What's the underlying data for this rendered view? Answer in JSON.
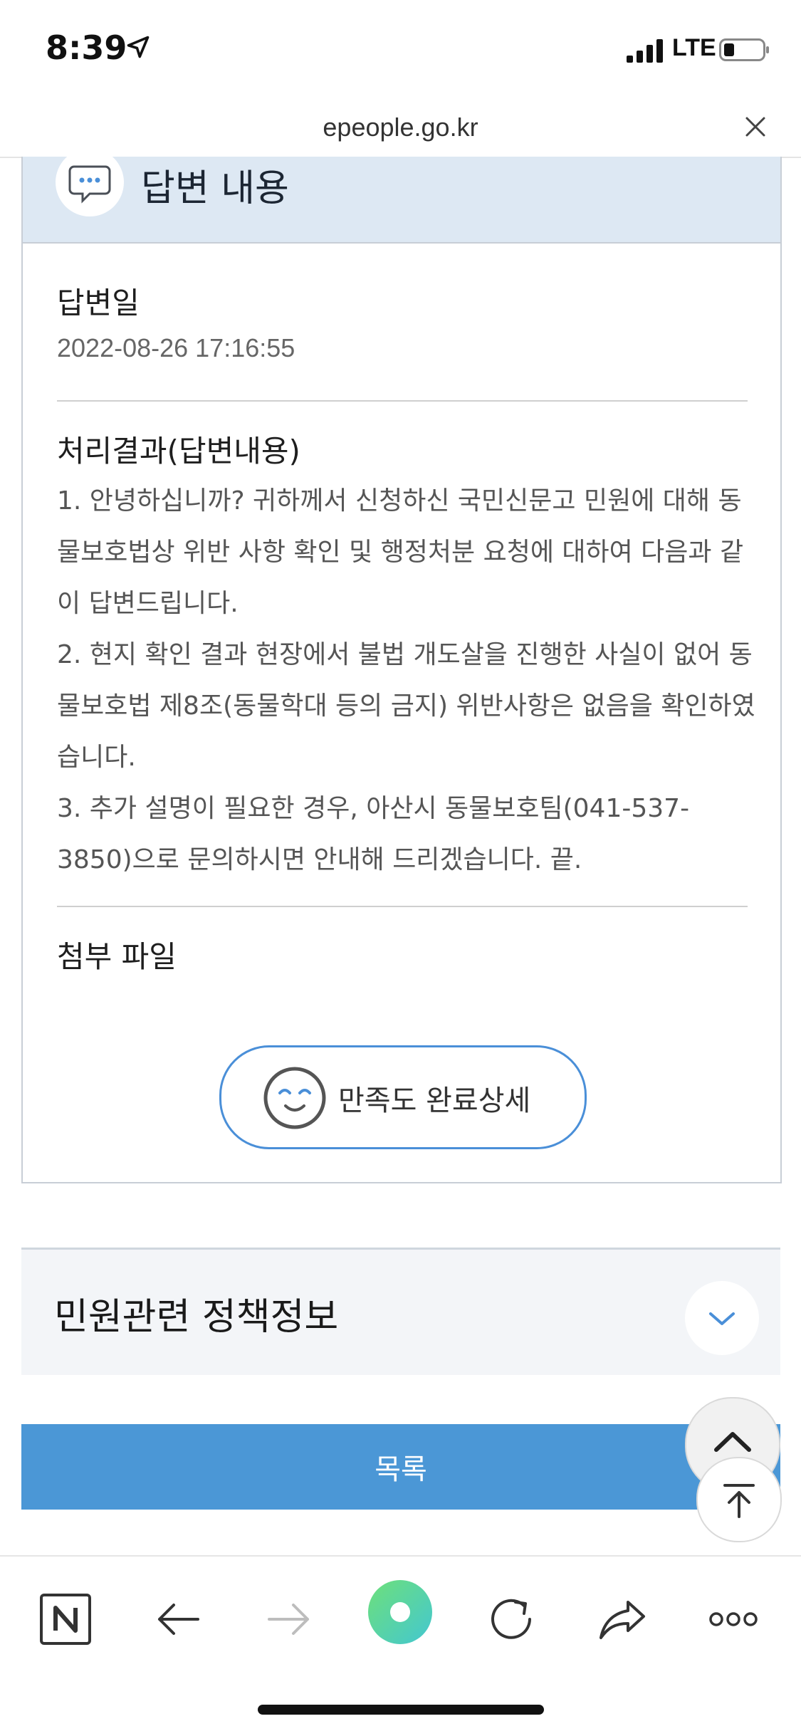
{
  "status_bar": {
    "time": "8:39",
    "network": "LTE"
  },
  "browser": {
    "url": "epeople.go.kr"
  },
  "answer": {
    "header_title": "답변 내용",
    "date_label": "답변일",
    "date_value": "2022-08-26 17:16:55",
    "result_label": "처리결과(답변내용)",
    "result_paragraphs": [
      "1. 안녕하십니까? 귀하께서 신청하신 국민신문고 민원에 대해 동물보호법상 위반 사항 확인 및 행정처분 요청에 대하여 다음과 같이 답변드립니다.",
      "2. 현지 확인 결과 현장에서 불법 개도살을 진행한 사실이 없어 동물보호법 제8조(동물학대 등의 금지) 위반사항은 없음을 확인하였습니다.",
      "3. 추가 설명이 필요한 경우, 아산시 동물보호팀(041-537-3850)으로 문의하시면 안내해 드리겠습니다. 끝."
    ],
    "attachment_label": "첨부 파일",
    "satisfaction_button": "만족도 완료상세"
  },
  "policy": {
    "title": "민원관련 정책정보"
  },
  "list_button": "목록",
  "colors": {
    "accent_blue": "#4b97d6",
    "header_bg": "#dde8f3",
    "go_button": "#5fd6a4"
  },
  "icons": [
    "location-arrow-icon",
    "signal-icon",
    "battery-icon",
    "close-icon",
    "chat-bubble-icon",
    "smile-icon",
    "chevron-down-icon",
    "chevron-up-icon",
    "arrow-to-top-icon",
    "naver-icon",
    "back-arrow-icon",
    "forward-arrow-icon",
    "go-button-icon",
    "reload-icon",
    "share-icon",
    "more-icon"
  ]
}
